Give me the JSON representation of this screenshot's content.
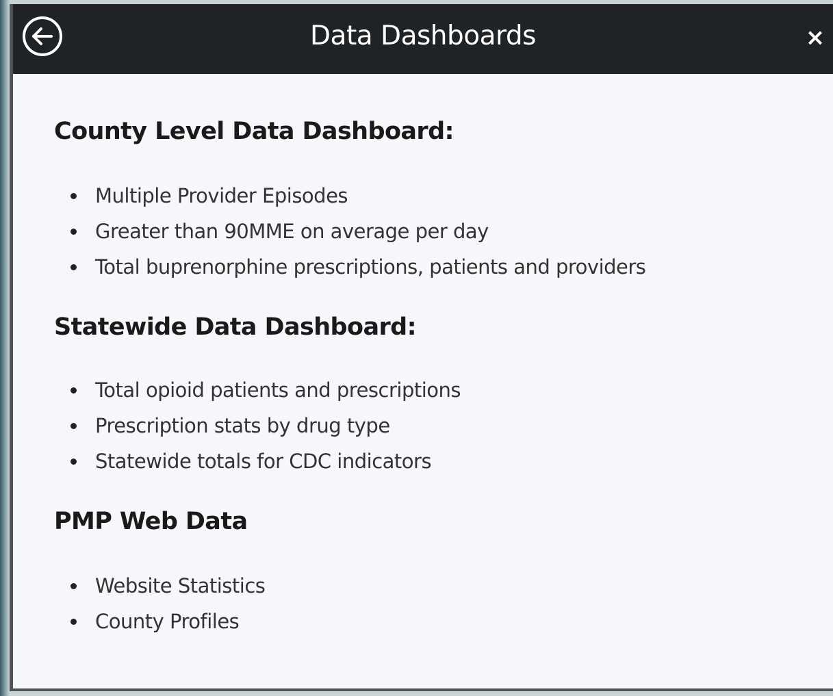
{
  "dialog": {
    "title": "Data Dashboards",
    "back_icon": "back-arrow-circle-icon",
    "close_label": "×"
  },
  "sections": [
    {
      "heading": "County Level Data Dashboard:",
      "items": [
        "Multiple Provider Episodes",
        "Greater than 90MME on average per day",
        "Total buprenorphine prescriptions, patients and providers"
      ]
    },
    {
      "heading": "Statewide Data Dashboard:",
      "items": [
        "Total opioid patients and prescriptions",
        "Prescription stats by drug type",
        "Statewide totals for CDC indicators"
      ]
    },
    {
      "heading": "PMP Web Data",
      "items": [
        "Website Statistics",
        "County Profiles"
      ]
    }
  ],
  "colors": {
    "header_bg": "#202326",
    "body_bg": "#f5f7fa",
    "heading_text": "#1a1a1a",
    "item_text": "#333333"
  }
}
